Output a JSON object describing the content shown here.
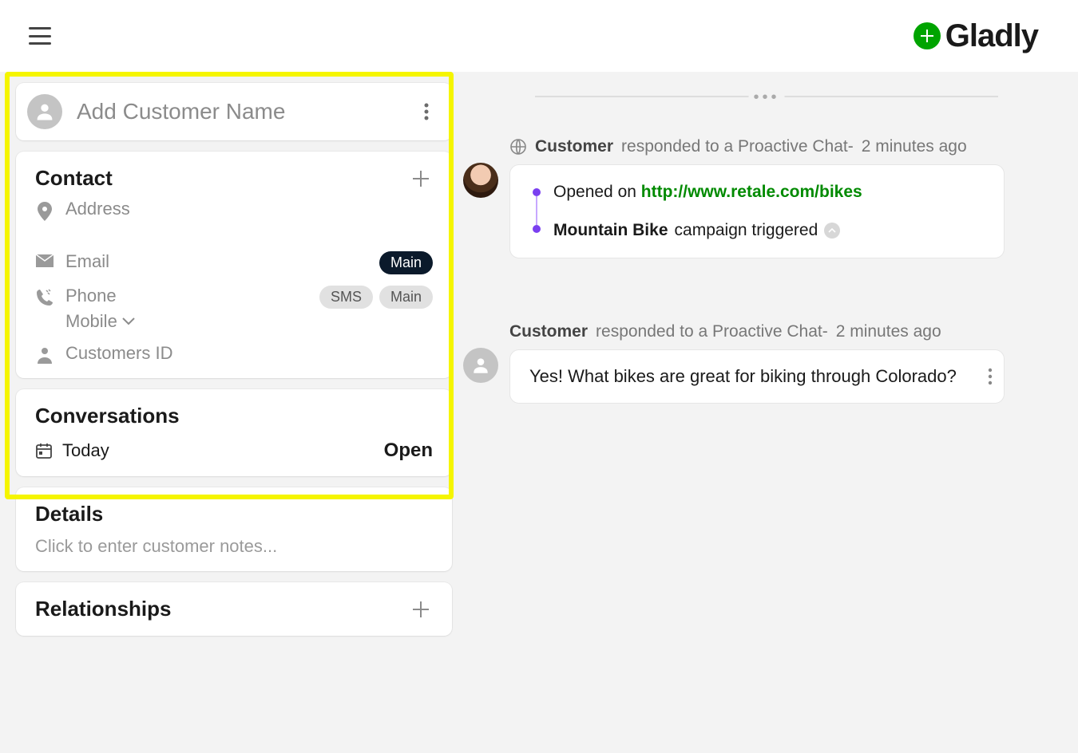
{
  "brand": {
    "name": "Gladly"
  },
  "customer": {
    "name_placeholder": "Add Customer Name"
  },
  "contact": {
    "title": "Contact",
    "address_label": "Address",
    "email_label": "Email",
    "email_badge_main": "Main",
    "phone_label": "Phone",
    "phone_badge_sms": "SMS",
    "phone_badge_main": "Main",
    "phone_subtype": "Mobile",
    "customer_id_label": "Customers ID"
  },
  "conversations": {
    "title": "Conversations",
    "date_label": "Today",
    "status": "Open"
  },
  "details": {
    "title": "Details",
    "placeholder": "Click to enter customer notes..."
  },
  "relationships": {
    "title": "Relationships"
  },
  "timeline": {
    "event1": {
      "actor": "Customer",
      "action": " responded to a Proactive Chat- ",
      "timestamp": "2 minutes ago",
      "opened_prefix": "Opened on ",
      "opened_url": "http://www.retale.com/bikes",
      "campaign_name": "Mountain Bike",
      "campaign_suffix": " campaign triggered"
    },
    "event2": {
      "actor": "Customer",
      "action": " responded to a Proactive Chat- ",
      "timestamp": "2 minutes ago",
      "message": "Yes! What bikes are great for biking through Colorado?"
    }
  }
}
